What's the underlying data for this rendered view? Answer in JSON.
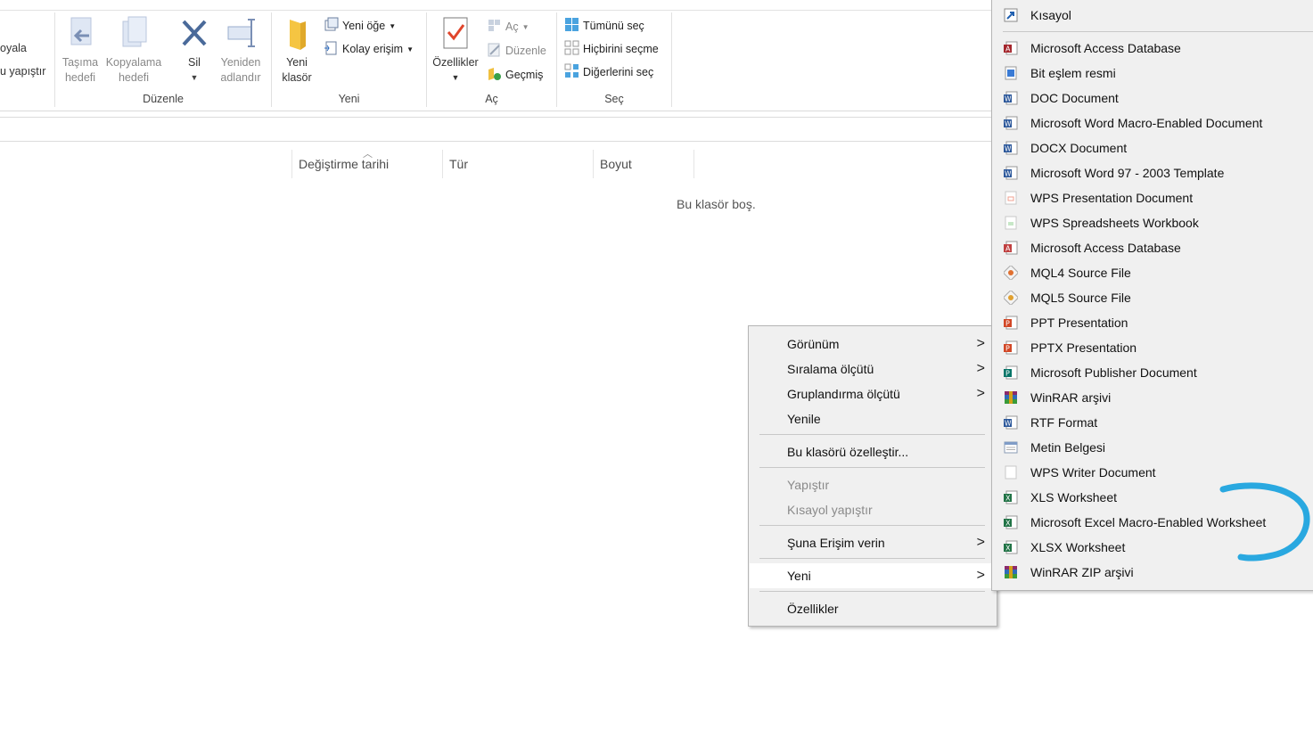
{
  "ribbon": {
    "partial_left": {
      "copy_label": "oyala",
      "paste_label": "u yapıştır"
    },
    "groups": {
      "organize": {
        "label": "Düzenle",
        "move_to": "Taşıma\nhedefi",
        "copy_to": "Kopyalama\nhedefi",
        "delete": "Sil",
        "rename": "Yeniden\nadlandır"
      },
      "new": {
        "label": "Yeni",
        "new_folder": "Yeni\nklasör",
        "new_item": "Yeni öğe",
        "easy_access": "Kolay erişim"
      },
      "open": {
        "label": "Aç",
        "properties": "Özellikler",
        "open": "Aç",
        "edit": "Düzenle",
        "history": "Geçmiş"
      },
      "select": {
        "label": "Seç",
        "select_all": "Tümünü seç",
        "select_none": "Hiçbirini seçme",
        "invert": "Diğerlerini seç"
      }
    }
  },
  "columns": [
    "Değiştirme tarihi",
    "Tür",
    "Boyut"
  ],
  "empty_message": "Bu klasör boş.",
  "context_menu": {
    "items": [
      {
        "label": "Görünüm"
      },
      {
        "label": "Sıralama ölçütü"
      },
      {
        "label": "Gruplandırma ölçütü"
      },
      {
        "label": "Yenile"
      },
      {
        "label": "Bu klasörü özelleştir..."
      },
      {
        "label": "Yapıştır"
      },
      {
        "label": "Kısayol yapıştır"
      },
      {
        "label": "Şuna Erişim verin"
      },
      {
        "label": "Yeni"
      },
      {
        "label": "Özellikler"
      }
    ]
  },
  "new_submenu": {
    "items": [
      {
        "label": "Kısayol",
        "icon": "shortcut-icon"
      },
      {
        "label": "Microsoft Access Database",
        "icon": "access-icon"
      },
      {
        "label": "Bit eşlem resmi",
        "icon": "bitmap-icon"
      },
      {
        "label": "DOC Document",
        "icon": "word-icon"
      },
      {
        "label": "Microsoft Word Macro-Enabled Document",
        "icon": "word-icon"
      },
      {
        "label": "DOCX Document",
        "icon": "word-icon"
      },
      {
        "label": "Microsoft Word 97 - 2003 Template",
        "icon": "word-icon"
      },
      {
        "label": "WPS Presentation Document",
        "icon": "wps-presentation-icon"
      },
      {
        "label": "WPS Spreadsheets Workbook",
        "icon": "wps-spreadsheet-icon"
      },
      {
        "label": "Microsoft Access Database",
        "icon": "access-icon"
      },
      {
        "label": "MQL4 Source File",
        "icon": "mql-icon"
      },
      {
        "label": "MQL5 Source File",
        "icon": "mql-icon"
      },
      {
        "label": "PPT Presentation",
        "icon": "powerpoint-icon"
      },
      {
        "label": "PPTX Presentation",
        "icon": "powerpoint-icon"
      },
      {
        "label": "Microsoft Publisher Document",
        "icon": "publisher-icon"
      },
      {
        "label": "WinRAR arşivi",
        "icon": "winrar-icon"
      },
      {
        "label": "RTF Format",
        "icon": "word-icon"
      },
      {
        "label": "Metin Belgesi",
        "icon": "text-document-icon"
      },
      {
        "label": "WPS Writer Document",
        "icon": "wps-writer-icon"
      },
      {
        "label": "XLS Worksheet",
        "icon": "excel-icon"
      },
      {
        "label": "Microsoft Excel Macro-Enabled Worksheet",
        "icon": "excel-icon"
      },
      {
        "label": "XLSX Worksheet",
        "icon": "excel-icon"
      },
      {
        "label": "WinRAR ZIP arşivi",
        "icon": "winrar-icon"
      }
    ]
  },
  "colors": {
    "menu_bg": "#f0f0f0",
    "highlight": "#ffffff",
    "annotation_stroke": "#29a8e0",
    "access": "#a4262c",
    "word": "#2b579a",
    "excel": "#217346",
    "powerpoint": "#d24726",
    "publisher": "#077568"
  }
}
